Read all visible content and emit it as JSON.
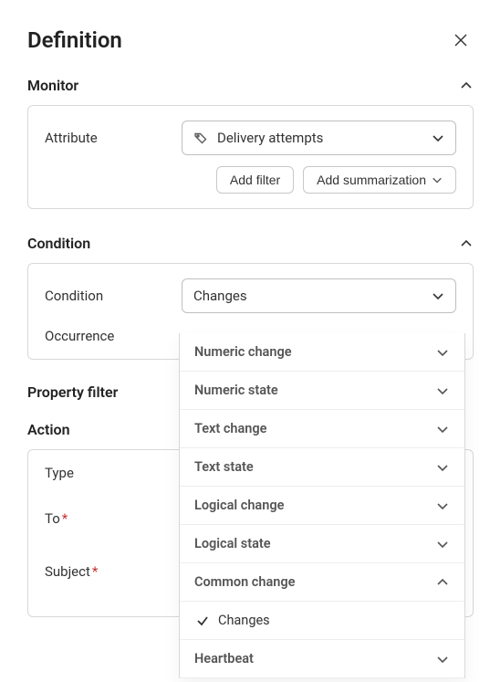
{
  "header": {
    "title": "Definition"
  },
  "monitor": {
    "title": "Monitor",
    "attribute_label": "Attribute",
    "attribute_value": "Delivery attempts",
    "add_filter_label": "Add filter",
    "add_summarization_label": "Add summarization"
  },
  "condition": {
    "title": "Condition",
    "condition_label": "Condition",
    "condition_value": "Changes",
    "occurrence_label": "Occurrence",
    "dropdown": {
      "groups": [
        {
          "label": "Numeric change",
          "expanded": false
        },
        {
          "label": "Numeric state",
          "expanded": false
        },
        {
          "label": "Text change",
          "expanded": false
        },
        {
          "label": "Text state",
          "expanded": false
        },
        {
          "label": "Logical change",
          "expanded": false
        },
        {
          "label": "Logical state",
          "expanded": false
        },
        {
          "label": "Common change",
          "expanded": true,
          "items": [
            {
              "label": "Changes",
              "selected": true
            }
          ]
        },
        {
          "label": "Heartbeat",
          "expanded": false
        }
      ]
    }
  },
  "property_filter": {
    "title": "Property filter"
  },
  "action": {
    "title": "Action",
    "type_label": "Type",
    "to_label": "To",
    "subject_label": "Subject"
  }
}
